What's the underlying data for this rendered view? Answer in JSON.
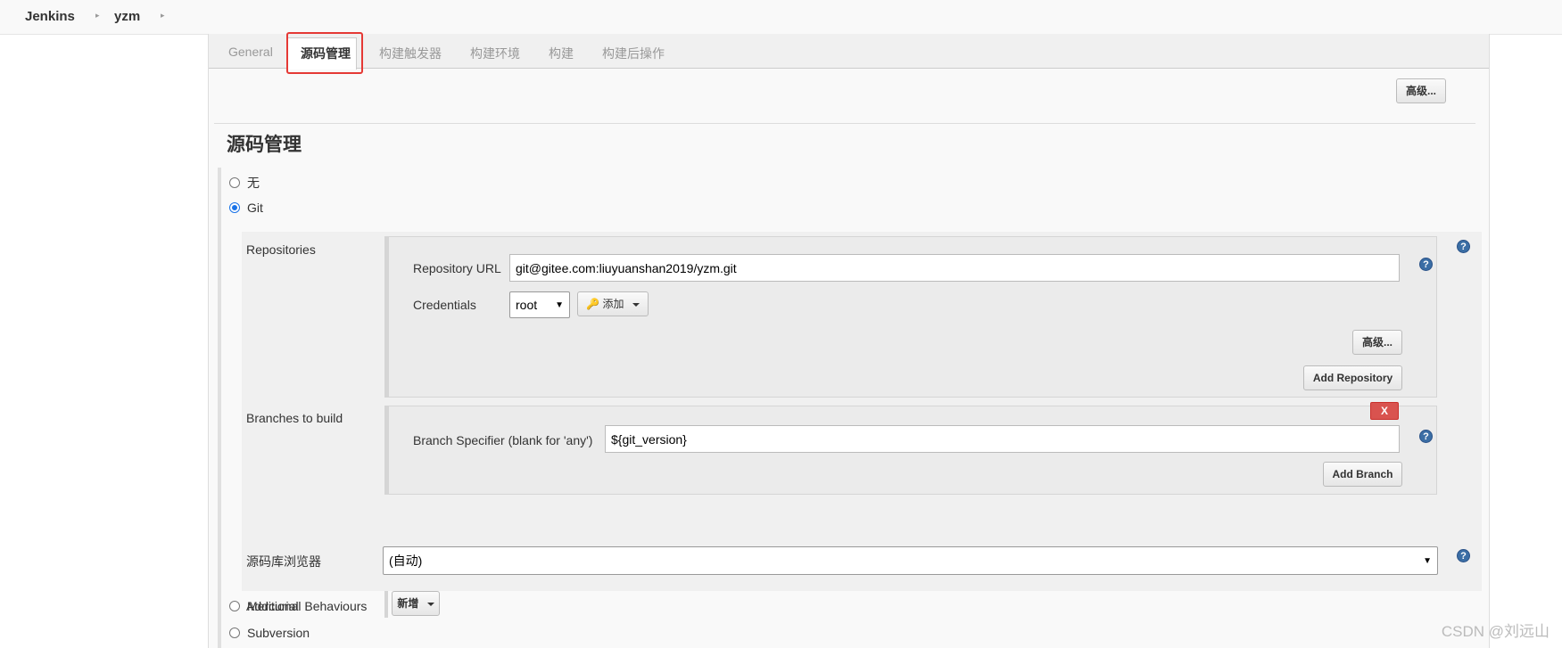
{
  "breadcrumb": {
    "root": "Jenkins",
    "job": "yzm"
  },
  "tabs": [
    "General",
    "源码管理",
    "构建触发器",
    "构建环境",
    "构建",
    "构建后操作"
  ],
  "advanced_label": "高级...",
  "section": {
    "title": "源码管理"
  },
  "scm_options": {
    "none": "无",
    "git": "Git",
    "mercurial": "Mercurial",
    "subversion": "Subversion"
  },
  "repositories": {
    "label": "Repositories",
    "url_label": "Repository URL",
    "url_value": "git@gitee.com:liuyuanshan2019/yzm.git",
    "credentials_label": "Credentials",
    "credentials_value": "root",
    "add_label": "添加",
    "advanced_label": "高级...",
    "add_repository_label": "Add Repository"
  },
  "branches": {
    "label": "Branches to build",
    "delete_label": "X",
    "specifier_label": "Branch Specifier (blank for 'any')",
    "specifier_value": "${git_version}",
    "add_branch_label": "Add Branch"
  },
  "browser": {
    "label": "源码库浏览器",
    "value": "(自动)"
  },
  "behaviours": {
    "label": "Additional Behaviours",
    "add_label": "新增"
  },
  "help_glyph": "?",
  "watermark": "CSDN @刘远山",
  "colors": {
    "accent": "#1a73e8",
    "highlight": "#e53935",
    "delete": "#d9534f",
    "help": "#3b6ea5"
  }
}
